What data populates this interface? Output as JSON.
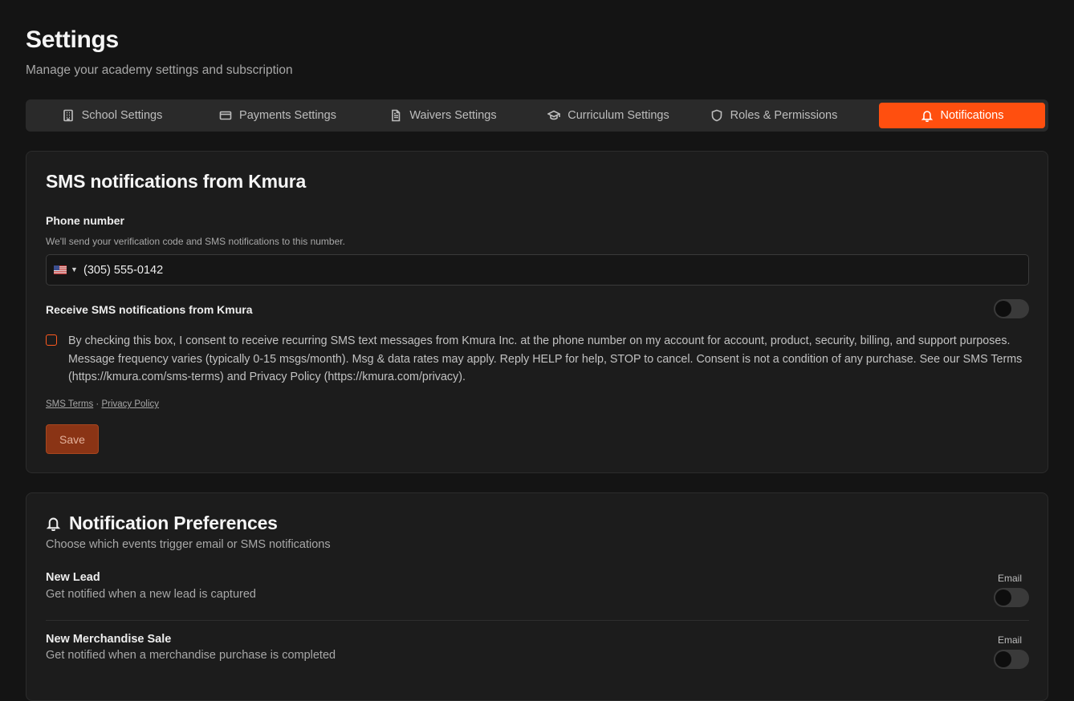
{
  "header": {
    "title": "Settings",
    "subtitle": "Manage your academy settings and subscription"
  },
  "tabs": [
    {
      "label": "School Settings",
      "icon": "building-icon",
      "active": false
    },
    {
      "label": "Payments Settings",
      "icon": "credit-card-icon",
      "active": false
    },
    {
      "label": "Waivers Settings",
      "icon": "document-icon",
      "active": false
    },
    {
      "label": "Curriculum Settings",
      "icon": "graduation-cap-icon",
      "active": false
    },
    {
      "label": "Roles & Permissions",
      "icon": "shield-icon",
      "active": false
    },
    {
      "label": "Notifications",
      "icon": "bell-icon",
      "active": true
    }
  ],
  "sms": {
    "title": "SMS notifications from Kmura",
    "phone_label": "Phone number",
    "phone_help": "We'll send your verification code and SMS notifications to this number.",
    "country_flag": "us-flag-icon",
    "phone_value": "(305) 555-0142",
    "receive_label": "Receive SMS notifications from Kmura",
    "receive_enabled": false,
    "consent_checked": false,
    "consent_text": "By checking this box, I consent to receive recurring SMS text messages from Kmura Inc. at the phone number on my account for account, product, security, billing, and support purposes. Message frequency varies (typically 0-15 msgs/month). Msg & data rates may apply. Reply HELP for help, STOP to cancel. Consent is not a condition of any purchase. See our SMS Terms (https://kmura.com/sms-terms) and Privacy Policy (https://kmura.com/privacy).",
    "terms_link": "SMS Terms",
    "separator": "·",
    "privacy_link": "Privacy Policy",
    "save_label": "Save"
  },
  "preferences": {
    "title": "Notification Preferences",
    "subtitle": "Choose which events trigger email or SMS notifications",
    "rows": [
      {
        "name": "New Lead",
        "description": "Get notified when a new lead is captured",
        "channel_label": "Email",
        "email_enabled": false
      },
      {
        "name": "New Merchandise Sale",
        "description": "Get notified when a merchandise purchase is completed",
        "channel_label": "Email",
        "email_enabled": false
      }
    ]
  },
  "colors": {
    "accent": "#ff4f0f",
    "background": "#141414",
    "card": "#1c1c1c"
  }
}
